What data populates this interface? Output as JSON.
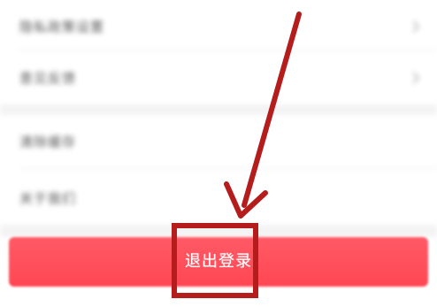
{
  "menu": {
    "items": [
      {
        "label": "隐私政策设置"
      },
      {
        "label": "意见反馈"
      },
      {
        "label": "清除缓存"
      },
      {
        "label": "关于我们"
      }
    ]
  },
  "logout": {
    "label": "退出登录",
    "color": "#ff4d5a"
  },
  "annotation": {
    "arrow_color": "#b51d1d",
    "icon": "arrow-pointer-icon"
  }
}
